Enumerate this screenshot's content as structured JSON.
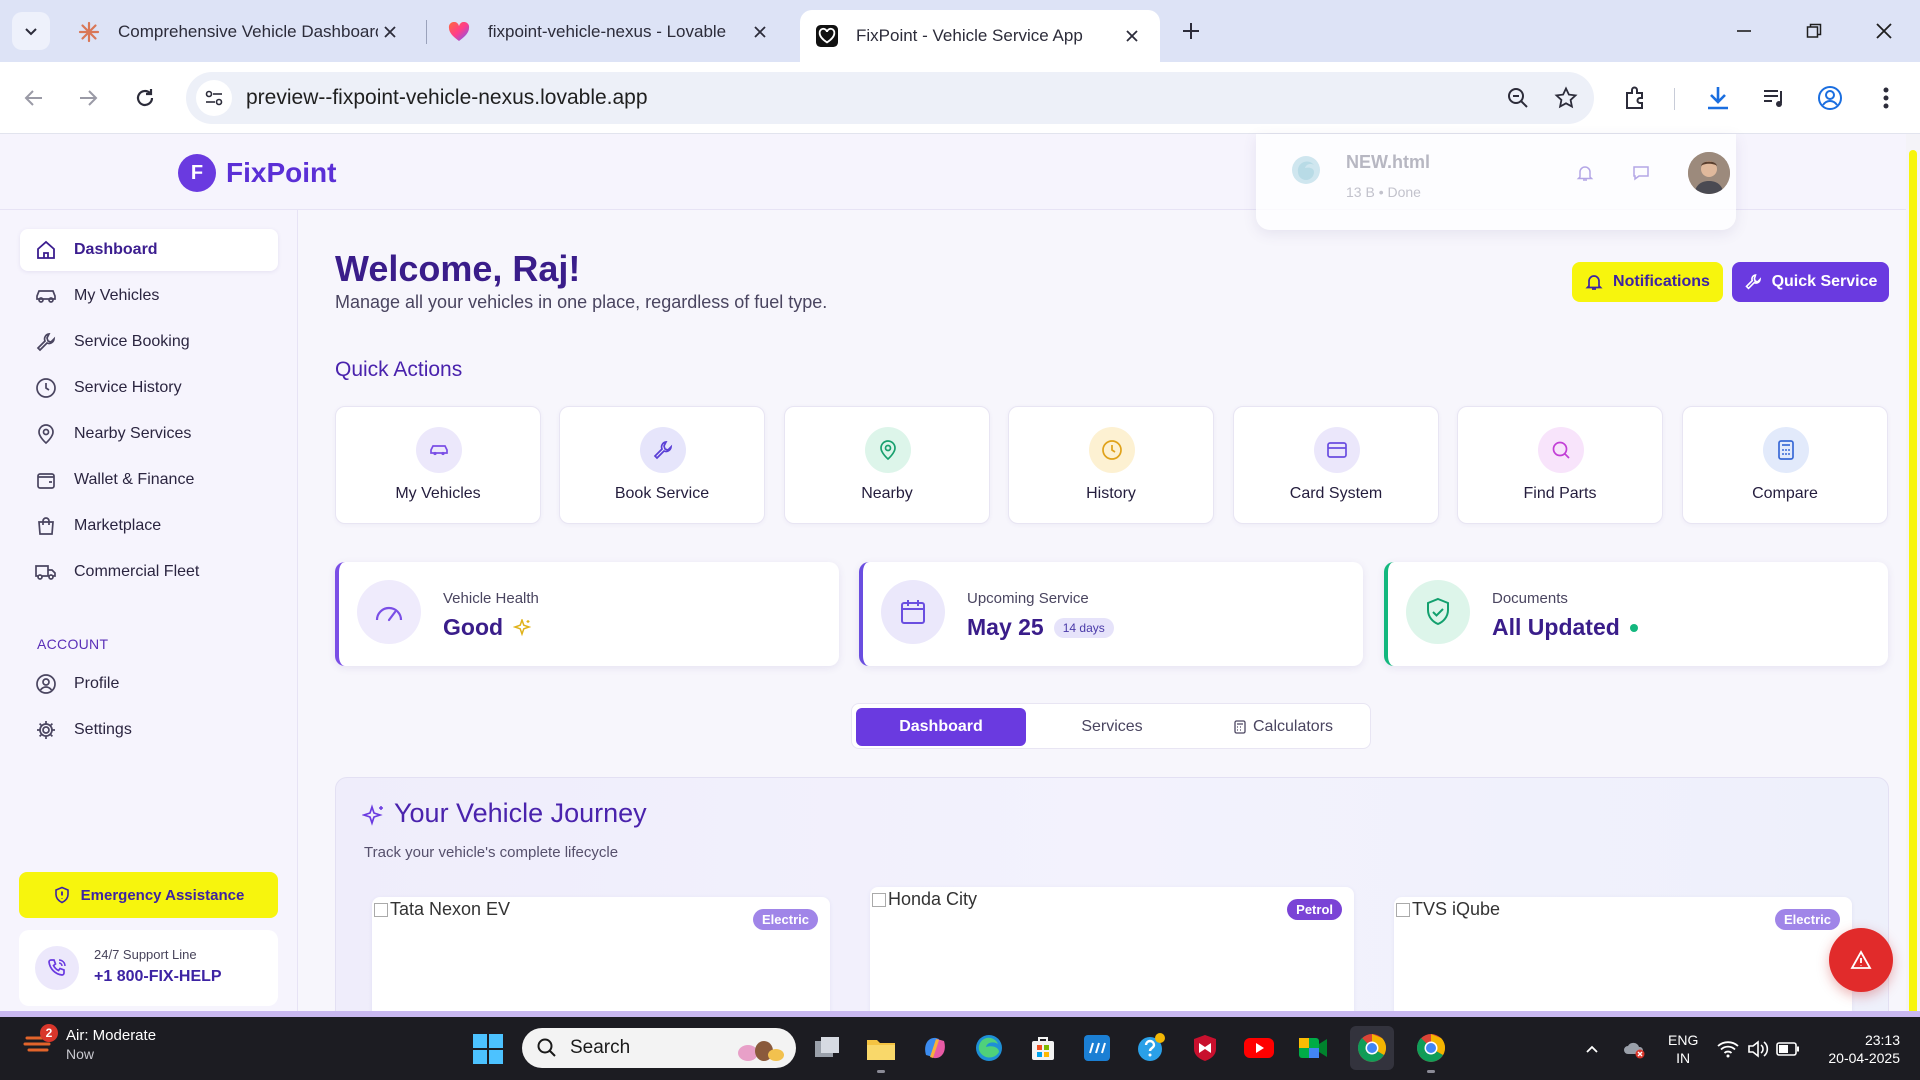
{
  "browser": {
    "tabs": [
      {
        "title": "Comprehensive Vehicle Dashboard",
        "favicon": "claude-icon"
      },
      {
        "title": "fixpoint-vehicle-nexus - Lovable",
        "favicon": "lovable-heart-icon"
      },
      {
        "title": "FixPoint - Vehicle Service App",
        "favicon": "fixpoint-heart-icon"
      }
    ],
    "active_tab": 2,
    "url": "preview--fixpoint-vehicle-nexus.lovable.app"
  },
  "header": {
    "logo_letter": "F",
    "logo_text": "FixPoint"
  },
  "download": {
    "file_name": "NEW.html",
    "status": "13 B • Done"
  },
  "sidebar": {
    "items": [
      {
        "label": "Dashboard",
        "icon": "home-icon",
        "active": true
      },
      {
        "label": "My Vehicles",
        "icon": "car-icon"
      },
      {
        "label": "Service Booking",
        "icon": "wrench-icon"
      },
      {
        "label": "Service History",
        "icon": "clock-icon"
      },
      {
        "label": "Nearby Services",
        "icon": "map-pin-icon"
      },
      {
        "label": "Wallet & Finance",
        "icon": "wallet-icon"
      },
      {
        "label": "Marketplace",
        "icon": "shopping-bag-icon"
      },
      {
        "label": "Commercial Fleet",
        "icon": "truck-icon"
      }
    ],
    "account_label": "ACCOUNT",
    "account_items": [
      {
        "label": "Profile",
        "icon": "user-circle-icon"
      },
      {
        "label": "Settings",
        "icon": "gear-icon"
      }
    ],
    "emergency_label": "Emergency Assistance",
    "support_label": "24/7 Support Line",
    "support_phone": "+1 800-FIX-HELP"
  },
  "main": {
    "welcome": "Welcome, Raj!",
    "welcome_sub": "Manage all your vehicles in one place, regardless of fuel type.",
    "notifications_label": "Notifications",
    "quick_service_label": "Quick Service",
    "quick_actions_title": "Quick Actions",
    "quick_actions": [
      {
        "label": "My Vehicles",
        "icon": "car-icon",
        "color": "#7a4ee6",
        "bg": "#ece8fb"
      },
      {
        "label": "Book Service",
        "icon": "wrench-icon",
        "color": "#5a3fd6",
        "bg": "#e6e5fb"
      },
      {
        "label": "Nearby",
        "icon": "map-pin-icon",
        "color": "#18a06e",
        "bg": "#ddf5ea"
      },
      {
        "label": "History",
        "icon": "clock-icon",
        "color": "#e0a21a",
        "bg": "#fdf1d2"
      },
      {
        "label": "Card System",
        "icon": "credit-card-icon",
        "color": "#6a4ee0",
        "bg": "#ebe7fb"
      },
      {
        "label": "Find Parts",
        "icon": "search-icon",
        "color": "#c23fd6",
        "bg": "#f8e4fb"
      },
      {
        "label": "Compare",
        "icon": "calculator-icon",
        "color": "#3a6ad6",
        "bg": "#e2eafb"
      }
    ],
    "stats": [
      {
        "label": "Vehicle Health",
        "value": "Good",
        "icon": "gauge-icon",
        "accent": "#7a4ee6",
        "extra": "sparkle"
      },
      {
        "label": "Upcoming Service",
        "value": "May 25",
        "badge": "14 days",
        "icon": "calendar-icon",
        "accent": "#6a4ee0"
      },
      {
        "label": "Documents",
        "value": "All Updated",
        "icon": "shield-check-icon",
        "accent": "#13b77e",
        "extra": "dot"
      }
    ],
    "segments": [
      {
        "label": "Dashboard",
        "active": true
      },
      {
        "label": "Services"
      },
      {
        "label": "Calculators",
        "icon": "calculator-icon"
      }
    ],
    "journey": {
      "title": "Your Vehicle Journey",
      "subtitle": "Track your vehicle's complete lifecycle",
      "vehicles": [
        {
          "name": "Tata Nexon EV",
          "fuel": "Electric"
        },
        {
          "name": "Honda City",
          "fuel": "Petrol"
        },
        {
          "name": "TVS iQube",
          "fuel": "Electric"
        }
      ]
    }
  },
  "taskbar": {
    "weather_title": "Air: Moderate",
    "weather_sub": "Now",
    "weather_badge": "2",
    "search_placeholder": "Search",
    "lang_line1": "ENG",
    "lang_line2": "IN",
    "time": "23:13",
    "date": "20-04-2025"
  }
}
